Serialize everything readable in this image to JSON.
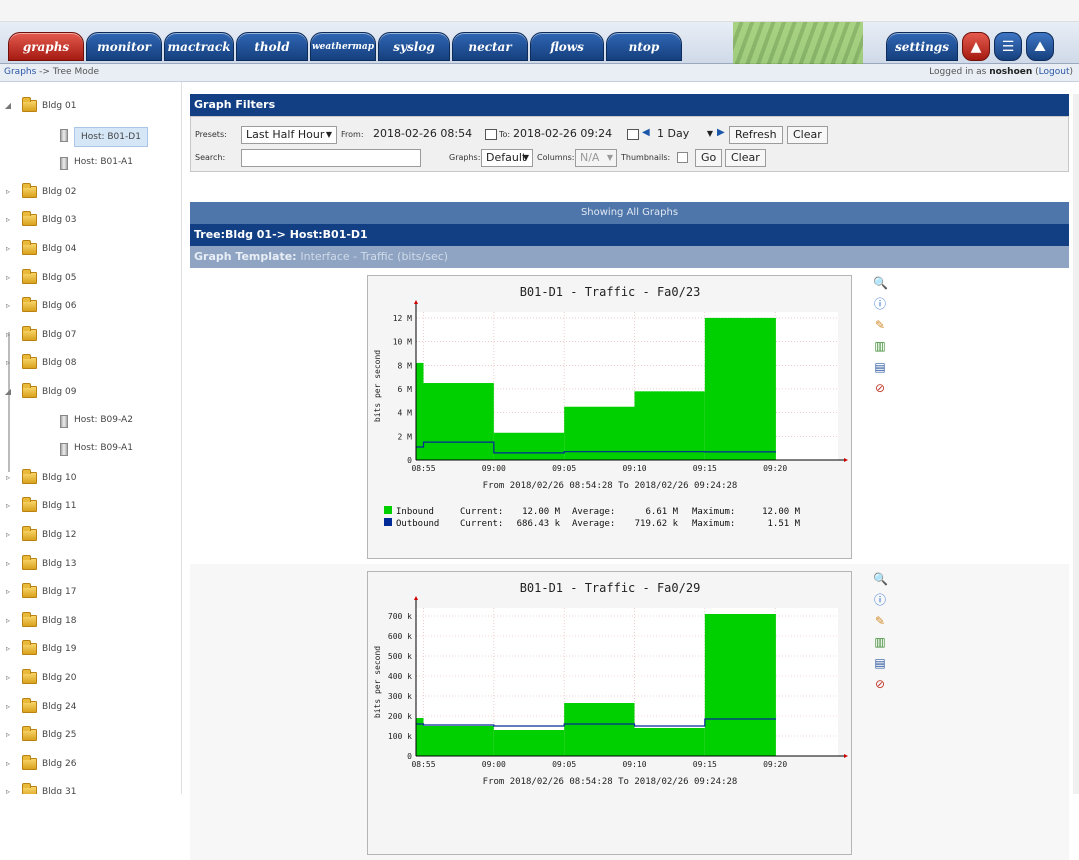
{
  "nav": {
    "tabs": [
      "graphs",
      "monitor",
      "mactrack",
      "thold",
      "weathermap",
      "syslog",
      "nectar",
      "flows",
      "ntop"
    ],
    "settings": "settings"
  },
  "crumb": {
    "root": "Graphs",
    "arrow": "->",
    "mode": "Tree Mode"
  },
  "login": {
    "prefix": "Logged in as",
    "user": "noshoen",
    "logout": "Logout"
  },
  "tree": [
    {
      "label": "Bldg 01",
      "kind": "folder",
      "expanded": true
    },
    {
      "label": "Host: B01-D1",
      "kind": "host",
      "selected": true
    },
    {
      "label": "Host: B01-A1",
      "kind": "host"
    },
    {
      "label": "Bldg 02",
      "kind": "folder"
    },
    {
      "label": "Bldg 03",
      "kind": "folder"
    },
    {
      "label": "Bldg 04",
      "kind": "folder"
    },
    {
      "label": "Bldg 05",
      "kind": "folder"
    },
    {
      "label": "Bldg 06",
      "kind": "folder"
    },
    {
      "label": "Bldg 07",
      "kind": "folder"
    },
    {
      "label": "Bldg 08",
      "kind": "folder"
    },
    {
      "label": "Bldg 09",
      "kind": "folder",
      "expanded": true
    },
    {
      "label": "Host: B09-A2",
      "kind": "host"
    },
    {
      "label": "Host: B09-A1",
      "kind": "host"
    },
    {
      "label": "Bldg 10",
      "kind": "folder"
    },
    {
      "label": "Bldg 11",
      "kind": "folder"
    },
    {
      "label": "Bldg 12",
      "kind": "folder"
    },
    {
      "label": "Bldg 13",
      "kind": "folder"
    },
    {
      "label": "Bldg 17",
      "kind": "folder"
    },
    {
      "label": "Bldg 18",
      "kind": "folder"
    },
    {
      "label": "Bldg 19",
      "kind": "folder"
    },
    {
      "label": "Bldg 20",
      "kind": "folder"
    },
    {
      "label": "Bldg 24",
      "kind": "folder"
    },
    {
      "label": "Bldg 25",
      "kind": "folder"
    },
    {
      "label": "Bldg 26",
      "kind": "folder"
    },
    {
      "label": "Bldg 31",
      "kind": "folder"
    }
  ],
  "filters": {
    "title": "Graph Filters",
    "presets_label": "Presets:",
    "presets_value": "Last Half Hour",
    "from_label": "From:",
    "from_value": "2018-02-26 08:54",
    "to_label": "To:",
    "to_value": "2018-02-26 09:24",
    "span_value": "1 Day",
    "refresh": "Refresh",
    "clear": "Clear",
    "search_label": "Search:",
    "search_value": "",
    "graphs_label": "Graphs:",
    "graphs_value": "Default",
    "columns_label": "Columns:",
    "columns_value": "N/A",
    "thumbnails_label": "Thumbnails:",
    "go": "Go",
    "clear2": "Clear"
  },
  "showing": "Showing All Graphs",
  "tree_path": "Tree:Bldg 01-> Host:B01-D1",
  "template": {
    "label": "Graph Template:",
    "value": "Interface - Traffic (bits/sec)"
  },
  "graphs": [
    {
      "title": "B01-D1 - Traffic - Fa0/23",
      "ylabel": "bits per second",
      "yticks": [
        "12 M",
        "10 M",
        "8 M",
        "6 M",
        "4 M",
        "2 M",
        "0"
      ],
      "xticks": [
        "08:55",
        "09:00",
        "09:05",
        "09:10",
        "09:15",
        "09:20"
      ],
      "range_text": "From 2018/02/26 08:54:28 To 2018/02/26 09:24:28",
      "legend": [
        {
          "name": "Inbound",
          "current": "12.00 M",
          "average": "6.61 M",
          "maximum": "12.00 M"
        },
        {
          "name": "Outbound",
          "current": "686.43 k",
          "average": "719.62 k",
          "maximum": "1.51 M"
        }
      ],
      "legend_labels": {
        "current": "Current:",
        "average": "Average:",
        "maximum": "Maximum:"
      }
    },
    {
      "title": "B01-D1 - Traffic - Fa0/29",
      "ylabel": "bits per second",
      "yticks": [
        "700 k",
        "600 k",
        "500 k",
        "400 k",
        "300 k",
        "200 k",
        "100 k",
        "0"
      ],
      "xticks": [
        "08:55",
        "09:00",
        "09:05",
        "09:10",
        "09:15",
        "09:20"
      ],
      "range_text": "From 2018/02/26 08:54:28 To 2018/02/26 09:24:28"
    }
  ],
  "chart_data": [
    {
      "type": "area",
      "title": "B01-D1 - Traffic - Fa0/23",
      "ylabel": "bits per second",
      "ylim": [
        0,
        12500000
      ],
      "x": [
        "08:54:28",
        "08:55",
        "09:00",
        "09:05",
        "09:10",
        "09:15",
        "09:20",
        "09:24:28"
      ],
      "series": [
        {
          "name": "Inbound",
          "color": "#00cf00",
          "step_x": [
            "08:54:28",
            "08:55",
            "09:00",
            "09:05",
            "09:10",
            "09:15",
            "09:20"
          ],
          "values": [
            8200000,
            6500000,
            2300000,
            4500000,
            5800000,
            12000000,
            12000000
          ]
        },
        {
          "name": "Outbound",
          "color": "#002a97",
          "step_x": [
            "08:54:28",
            "08:55",
            "09:00",
            "09:05",
            "09:10",
            "09:15",
            "09:20"
          ],
          "values": [
            1100000,
            1510000,
            600000,
            700000,
            700000,
            686430,
            686430
          ]
        }
      ]
    },
    {
      "type": "area",
      "title": "B01-D1 - Traffic - Fa0/29",
      "ylabel": "bits per second",
      "ylim": [
        0,
        740000
      ],
      "x": [
        "08:54:28",
        "08:55",
        "09:00",
        "09:05",
        "09:10",
        "09:15",
        "09:20",
        "09:24:28"
      ],
      "series": [
        {
          "name": "Inbound",
          "color": "#00cf00",
          "step_x": [
            "08:54:28",
            "08:55",
            "09:00",
            "09:05",
            "09:10",
            "09:15",
            "09:20"
          ],
          "values": [
            190000,
            150000,
            130000,
            265000,
            140000,
            710000,
            710000
          ]
        },
        {
          "name": "Outbound",
          "color": "#002a97",
          "step_x": [
            "08:54:28",
            "08:55",
            "09:00",
            "09:05",
            "09:10",
            "09:15",
            "09:20"
          ],
          "values": [
            160000,
            155000,
            150000,
            160000,
            150000,
            185000,
            185000
          ]
        }
      ]
    }
  ]
}
